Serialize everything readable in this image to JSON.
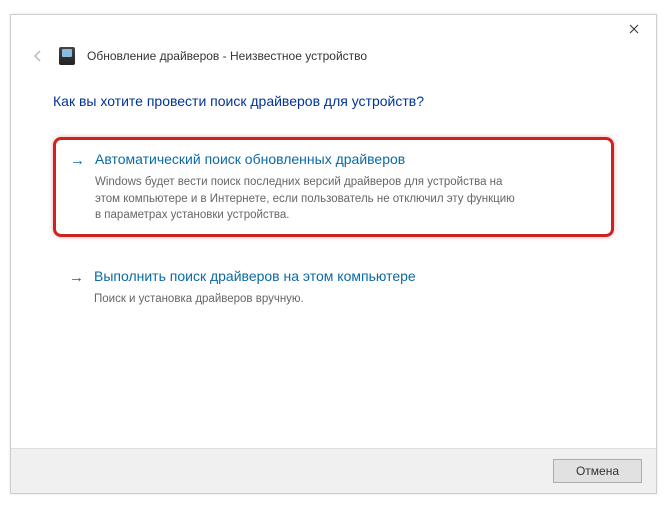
{
  "window": {
    "title": "Обновление драйверов - Неизвестное устройство"
  },
  "heading": "Как вы хотите провести поиск драйверов для устройств?",
  "options": {
    "auto": {
      "title": "Автоматический поиск обновленных драйверов",
      "desc": "Windows будет вести поиск последних версий драйверов для устройства на этом компьютере и в Интернете, если пользователь не отключил эту функцию в параметрах установки устройства."
    },
    "manual": {
      "title": "Выполнить поиск драйверов на этом компьютере",
      "desc": "Поиск и установка драйверов вручную."
    }
  },
  "buttons": {
    "cancel": "Отмена"
  }
}
